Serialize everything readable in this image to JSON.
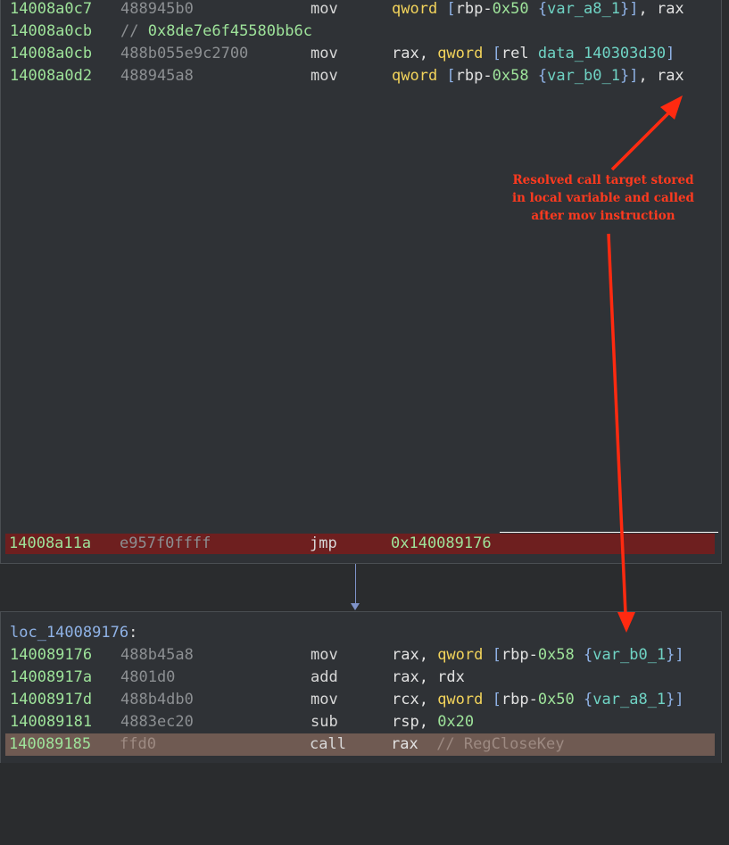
{
  "top_block": {
    "lines": [
      {
        "addr": "14008a0c7",
        "bytes": "488945b0",
        "mnem": "mov",
        "ops": {
          "kw": "qword",
          "br1": " [",
          "reg": "rbp",
          "minus": "-",
          "num": "0x50",
          "sp": " ",
          "br2": "{",
          "var": "var_a8_1",
          "br3": "}",
          "br4": "]",
          "rest": ", rax"
        }
      },
      {
        "addr": "14008a0cb",
        "comment_prefix": "// ",
        "comment_value": "0x8de7e6f45580bb6c"
      },
      {
        "addr": "14008a0cb",
        "bytes": "488b055e9c2700",
        "mnem": "mov",
        "ops": {
          "pre": "rax, ",
          "kw": "qword",
          "br1": " [",
          "rel": "rel ",
          "sym": "data_140303d30",
          "br2": "]"
        }
      },
      {
        "addr": "14008a0d2",
        "bytes": "488945a8",
        "mnem": "mov",
        "ops": {
          "kw": "qword",
          "br1": " [",
          "reg": "rbp",
          "minus": "-",
          "num": "0x58",
          "sp": " ",
          "br2": "{",
          "var": "var_b0_1",
          "br3": "}",
          "br4": "]",
          "rest": ", rax"
        }
      }
    ],
    "jmp_line": {
      "addr": "14008a11a",
      "bytes": "e957f0ffff",
      "mnem": "jmp",
      "target": "0x140089176"
    }
  },
  "annotation": {
    "line1": "Resolved call target stored",
    "line2": "in local variable and called",
    "line3": "after mov instruction"
  },
  "bottom_block": {
    "label": "loc_140089176",
    "label_suffix": ":",
    "lines": [
      {
        "addr": "140089176",
        "bytes": "488b45a8",
        "mnem": "mov",
        "ops": {
          "pre": "rax, ",
          "kw": "qword",
          "br1": " [",
          "reg": "rbp",
          "minus": "-",
          "num": "0x58",
          "sp": " ",
          "br2": "{",
          "var": "var_b0_1",
          "br3": "}",
          "br4": "]"
        }
      },
      {
        "addr": "14008917a",
        "bytes": "4801d0",
        "mnem": "add",
        "ops_plain": "rax, rdx"
      },
      {
        "addr": "14008917d",
        "bytes": "488b4db0",
        "mnem": "mov",
        "ops": {
          "pre": "rcx, ",
          "kw": "qword",
          "br1": " [",
          "reg": "rbp",
          "minus": "-",
          "num": "0x50",
          "sp": " ",
          "br2": "{",
          "var": "var_a8_1",
          "br3": "}",
          "br4": "]"
        }
      },
      {
        "addr": "140089181",
        "bytes": "4883ec20",
        "mnem": "sub",
        "ops_pre": "rsp, ",
        "ops_num": "0x20"
      },
      {
        "addr": "140089185",
        "bytes": "ffd0",
        "mnem": "call",
        "ops_plain": "rax",
        "comment": "  // RegCloseKey"
      }
    ]
  },
  "colors": {
    "address": "#9ee39a",
    "bytes": "#8c8f92",
    "keyword": "#f2d35b",
    "bracket": "#8fb2e6",
    "variable": "#6fd3c4",
    "jmp_highlight": "#6e1f1f",
    "call_highlight": "#6f5a52",
    "annotation": "#ff3a1f"
  }
}
